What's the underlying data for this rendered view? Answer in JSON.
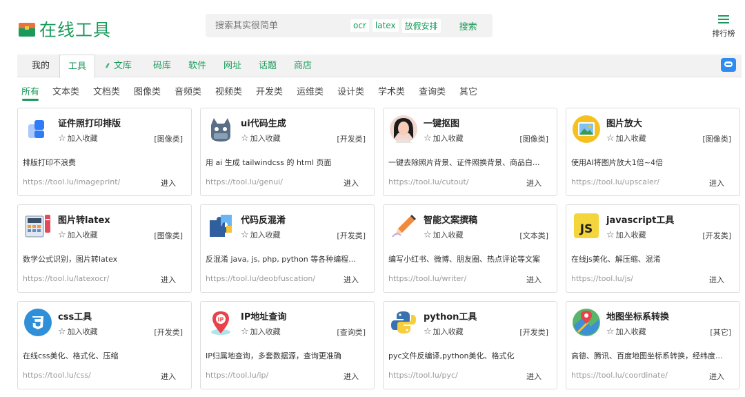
{
  "header": {
    "logo_text": "在线工具",
    "search_placeholder": "搜索其实很简单",
    "search_tags": [
      "ocr",
      "latex",
      "放假安排"
    ],
    "search_button": "搜索",
    "rank_label": "排行榜"
  },
  "nav": {
    "items": [
      "我的",
      "工具",
      "文库",
      "码库",
      "软件",
      "网址",
      "话题",
      "商店"
    ]
  },
  "categories": [
    "所有",
    "文本类",
    "文档类",
    "图像类",
    "音频类",
    "视频类",
    "开发类",
    "运维类",
    "设计类",
    "学术类",
    "查询类",
    "其它"
  ],
  "fav_label": "加入收藏",
  "enter_label": "进入",
  "cards": [
    {
      "title": "证件照打印排版",
      "cat": "[图像类]",
      "desc": "排版打印不浪费",
      "url": "https://tool.lu/imageprint/",
      "icon": "print-layout-icon"
    },
    {
      "title": "ui代码生成",
      "cat": "[开发类]",
      "desc": "用 ai 生成 tailwindcss 的 html 页面",
      "url": "https://tool.lu/genui/",
      "icon": "cat-mascot-icon"
    },
    {
      "title": "一键抠图",
      "cat": "[图像类]",
      "desc": "一键去除照片背景、证件照换背景、商品白...",
      "url": "https://tool.lu/cutout/",
      "icon": "portrait-icon"
    },
    {
      "title": "图片放大",
      "cat": "[图像类]",
      "desc": "使用AI将图片放大1倍~4倍",
      "url": "https://tool.lu/upscaler/",
      "icon": "image-icon"
    },
    {
      "title": "图片转latex",
      "cat": "[图像类]",
      "desc": "数学公式识别，图片转latex",
      "url": "https://tool.lu/latexocr/",
      "icon": "calculator-icon"
    },
    {
      "title": "代码反混淆",
      "cat": "[开发类]",
      "desc": "反混淆 java, js, php, python 等各种编程...",
      "url": "https://tool.lu/deobfuscation/",
      "icon": "puzzle-icon"
    },
    {
      "title": "智能文案撰稿",
      "cat": "[文本类]",
      "desc": "编写小红书、微博、朋友圈、热点评论等文案",
      "url": "https://tool.lu/writer/",
      "icon": "pen-icon"
    },
    {
      "title": "javascript工具",
      "cat": "[开发类]",
      "desc": "在线js美化、解压缩、混淆",
      "url": "https://tool.lu/js/",
      "icon": "js-icon"
    },
    {
      "title": "css工具",
      "cat": "[开发类]",
      "desc": "在线css美化、格式化、压缩",
      "url": "https://tool.lu/css/",
      "icon": "css3-icon"
    },
    {
      "title": "IP地址查询",
      "cat": "[查询类]",
      "desc": "IP归属地查询，多套数据源，查询更准确",
      "url": "https://tool.lu/ip/",
      "icon": "location-pin-icon"
    },
    {
      "title": "python工具",
      "cat": "[开发类]",
      "desc": "pyc文件反编译,python美化、格式化",
      "url": "https://tool.lu/pyc/",
      "icon": "python-icon"
    },
    {
      "title": "地图坐标系转换",
      "cat": "[其它]",
      "desc": "高德、腾讯、百度地图坐标系转换，经纬度...",
      "url": "https://tool.lu/coordinate/",
      "icon": "map-icon"
    }
  ]
}
